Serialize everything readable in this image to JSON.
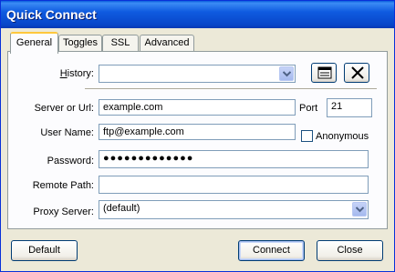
{
  "window": {
    "title": "Quick Connect"
  },
  "tabs": [
    {
      "label": "General",
      "active": true
    },
    {
      "label": "Toggles",
      "active": false
    },
    {
      "label": "SSL",
      "active": false
    },
    {
      "label": "Advanced",
      "active": false
    }
  ],
  "form": {
    "history": {
      "label": "History:",
      "value": ""
    },
    "server": {
      "label": "Server or Url:",
      "value": "example.com"
    },
    "port": {
      "label": "Port",
      "value": "21"
    },
    "username": {
      "label": "User Name:",
      "value": "ftp@example.com"
    },
    "anonymous": {
      "label": "Anonymous",
      "checked": false
    },
    "password": {
      "label": "Password:",
      "value": "●●●●●●●●●●●●●"
    },
    "remote_path": {
      "label": "Remote Path:",
      "value": ""
    },
    "proxy": {
      "label": "Proxy Server:",
      "value": "(default)"
    }
  },
  "toolbar_icons": [
    "notes-icon",
    "delete-x-icon"
  ],
  "buttons": {
    "default": "Default",
    "connect": "Connect",
    "close": "Close"
  }
}
